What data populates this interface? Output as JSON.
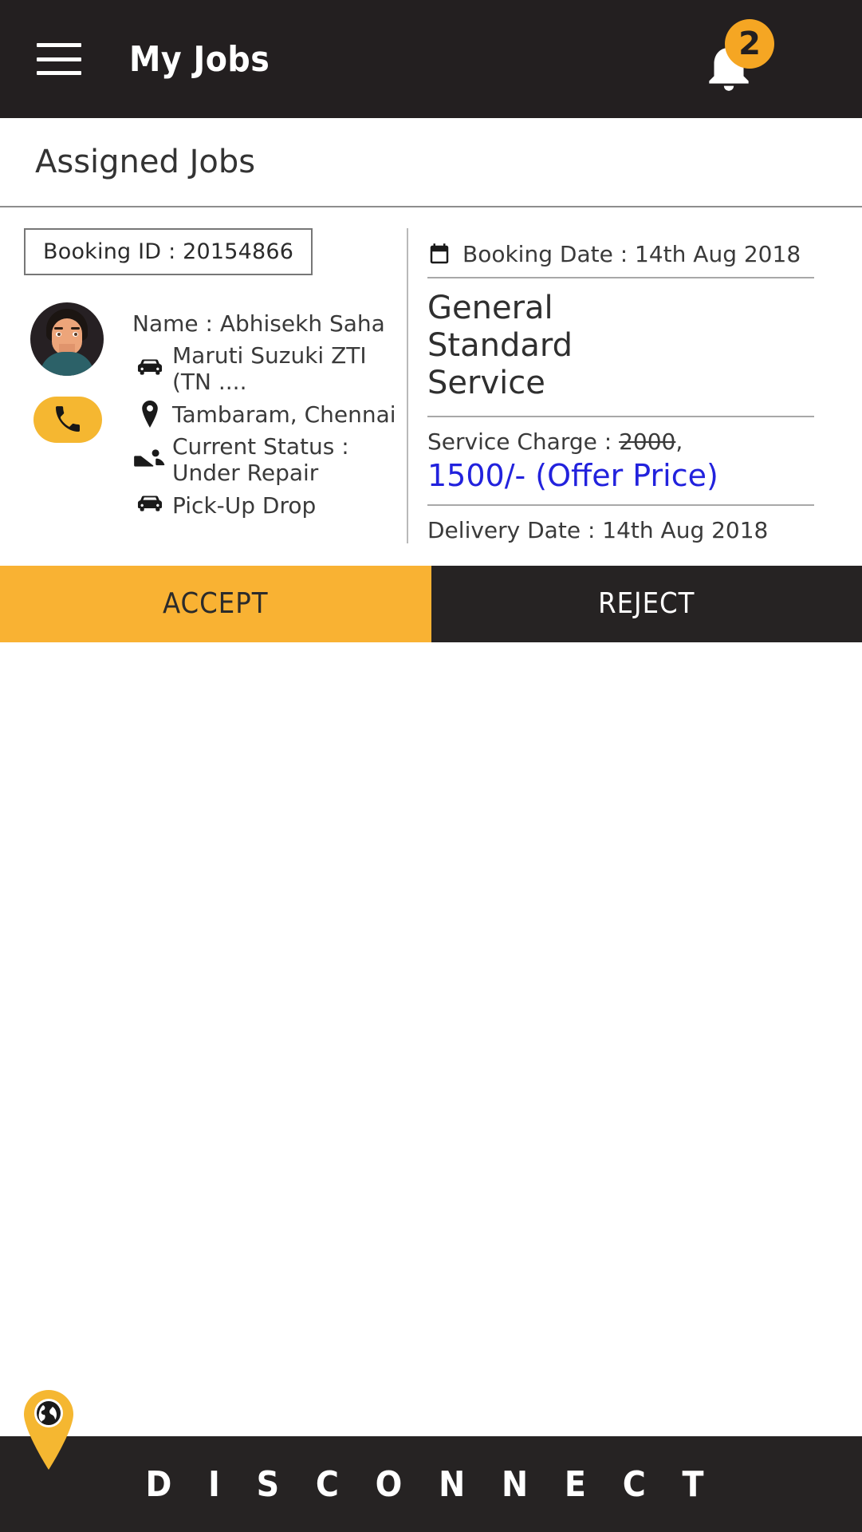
{
  "appbar": {
    "title": "My Jobs",
    "menu_icon": "hamburger-menu-icon",
    "notification_icon": "bell-icon",
    "notification_count": "2",
    "background_color": "#231f20",
    "badge_color": "#f5a623"
  },
  "section": {
    "title": "Assigned Jobs"
  },
  "job": {
    "booking_id_label": "Booking ID : 20154866",
    "customer_name": "Name : Abhisekh Saha",
    "vehicle": "Maruti Suzuki ZTI (TN ....",
    "location": "Tambaram, Chennai",
    "current_status": "Current Status : Under Repair",
    "pickup_drop": "Pick-Up Drop",
    "call_icon": "phone-icon",
    "avatar_icon": "customer-avatar",
    "vehicle_icon": "car-icon",
    "location_icon": "map-marker-icon",
    "status_icon": "car-repair-icon",
    "pickup_icon": "car-icon",
    "booking_date": "Booking Date : 14th Aug 2018",
    "calendar_icon": "calendar-icon",
    "service_name": "General Standard Service",
    "service_charge_prefix": "Service Charge : ",
    "service_charge_original": "2000",
    "service_charge_suffix": ",",
    "offer_price": "1500/- (Offer Price)",
    "offer_price_color": "#2222dd",
    "delivery_date": "Delivery Date : 14th Aug 2018"
  },
  "actions": {
    "accept_label": "ACCEPT",
    "reject_label": "REJECT",
    "accept_color": "#f9b233",
    "reject_color": "#262323"
  },
  "bottom": {
    "disconnect_label": "D I S C O N N E C T",
    "map_pin_icon": "map-pin-globe-icon",
    "bar_color": "#262323",
    "pin_color": "#f5b731"
  }
}
